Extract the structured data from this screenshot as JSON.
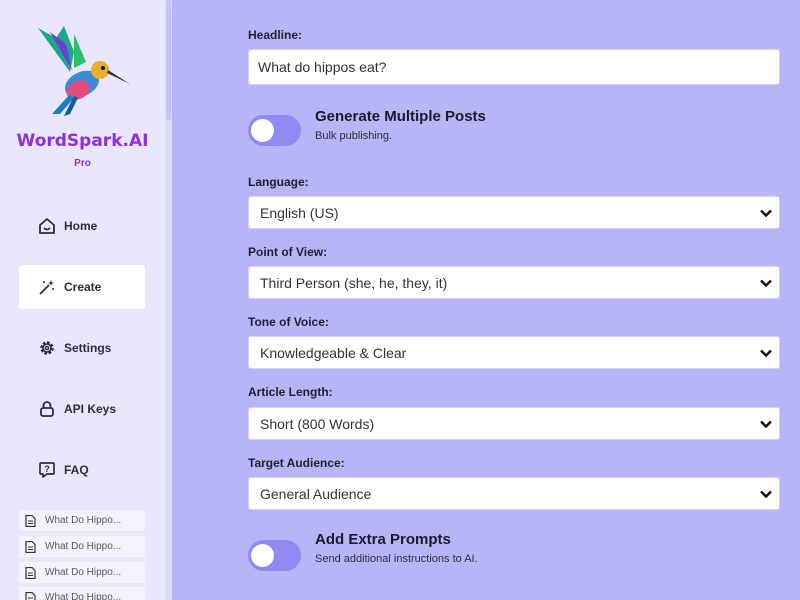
{
  "app": {
    "brand": "WordSpark.AI",
    "tier": "Pro"
  },
  "sidebar": {
    "nav": [
      {
        "label": "Home",
        "icon": "home-icon"
      },
      {
        "label": "Create",
        "icon": "magic-wand-icon",
        "active": true
      },
      {
        "label": "Settings",
        "icon": "gear-icon"
      },
      {
        "label": "API Keys",
        "icon": "lock-icon"
      },
      {
        "label": "FAQ",
        "icon": "question-icon"
      }
    ],
    "recent": [
      {
        "label": "What Do Hippo..."
      },
      {
        "label": "What Do Hippo..."
      },
      {
        "label": "What Do Hippo..."
      },
      {
        "label": "What Do Hippo..."
      }
    ]
  },
  "form": {
    "headline": {
      "label": "Headline:",
      "value": "What do hippos eat?"
    },
    "multiple_posts": {
      "title": "Generate Multiple Posts",
      "desc": "Bulk publishing.",
      "on": false
    },
    "language": {
      "label": "Language:",
      "value": "English (US)"
    },
    "point_of_view": {
      "label": "Point of View:",
      "value": "Third Person (she, he, they, it)"
    },
    "tone": {
      "label": "Tone of Voice:",
      "value": "Knowledgeable & Clear"
    },
    "length": {
      "label": "Article Length:",
      "value": "Short (800 Words)"
    },
    "audience": {
      "label": "Target Audience:",
      "value": "General Audience"
    },
    "extra_prompts": {
      "title": "Add Extra Prompts",
      "desc": "Send additional instructions to AI.",
      "on": false
    }
  },
  "colors": {
    "brand": "#8e2ee0",
    "background": "#b7b5f7",
    "sidebar": "#e9e7fb",
    "toggle": "#8f8bf3"
  }
}
